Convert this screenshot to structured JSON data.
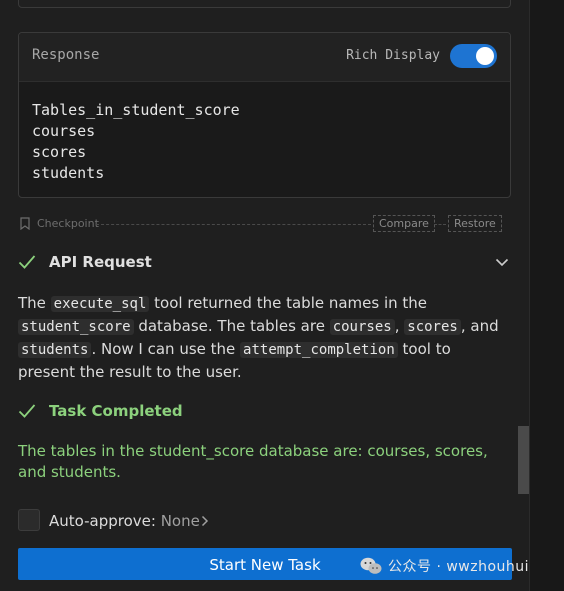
{
  "response": {
    "title": "Response",
    "rich_display_label": "Rich Display",
    "rich_display_on": true,
    "lines": [
      "Tables_in_student_score",
      "courses",
      "scores",
      "students"
    ]
  },
  "checkpoint": {
    "label": "Checkpoint",
    "compare": "Compare",
    "restore": "Restore"
  },
  "api_request": {
    "title": "API Request"
  },
  "message": {
    "t1": "The ",
    "c1": "execute_sql",
    "t2": " tool returned the table names in the ",
    "c2": "student_score",
    "t3": " database. The tables are ",
    "c3": "courses",
    "t4": ", ",
    "c4": "scores",
    "t5": ", and ",
    "c5": "students",
    "t6": ". Now I can use the ",
    "c6": "attempt_completion",
    "t7": " tool to present the result to the user."
  },
  "task": {
    "title": "Task Completed",
    "result": "The tables in the student_score database are: courses, scores, and students."
  },
  "auto_approve": {
    "label": "Auto-approve: ",
    "value": "None"
  },
  "start_button": "Start New Task",
  "watermark": "公众号 · wwzhouhui",
  "colors": {
    "accent": "#0e6fd0",
    "success": "#8cd17d",
    "background": "#1f1f1f"
  }
}
